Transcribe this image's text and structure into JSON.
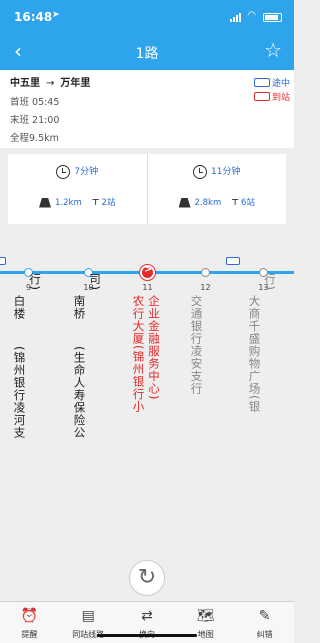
{
  "status": {
    "time": "16:48",
    "location_icon": "location-arrow-icon"
  },
  "navbar": {
    "back_icon": "‹",
    "title": "1路",
    "favorite_icon": "☆"
  },
  "info": {
    "from": "中五里",
    "arrow": "→",
    "to": "万年里",
    "first_bus": "首班 05:45",
    "last_bus": "末班 21:00",
    "length": "全程9.5km",
    "legend": [
      {
        "label": "途中",
        "color": "#2a6bd6"
      },
      {
        "label": "到站",
        "color": "#e52a2a"
      }
    ]
  },
  "cards": [
    {
      "time": "7分钟",
      "distance": "1.2km",
      "stops": "2站"
    },
    {
      "time": "11分钟",
      "distance": "2.8km",
      "stops": "6站"
    }
  ],
  "stops": [
    {
      "num": "9",
      "cols": [
        "白楼",
        "(锦州银行凌河支"
      ],
      "tail": "行)",
      "state": "upcoming"
    },
    {
      "num": "10",
      "cols": [
        "南桥",
        "(生命人寿保险公"
      ],
      "tail": "司)",
      "state": "upcoming"
    },
    {
      "num": "11",
      "cols": [
        "农行大厦(锦州银行小",
        "企业金融服务中心)"
      ],
      "tail": "",
      "state": "current"
    },
    {
      "num": "12",
      "cols": [
        "交通银行凌安支行"
      ],
      "tail": "",
      "state": "passed"
    },
    {
      "num": "13",
      "cols": [
        "大商千盛购物广场(银"
      ],
      "tail": "行)",
      "state": "passed"
    }
  ],
  "refresh_icon": "↻",
  "tabs": [
    {
      "label": "提醒",
      "icon": "⏰"
    },
    {
      "label": "同站线路",
      "icon": "▤"
    },
    {
      "label": "换向",
      "icon": "⇄"
    },
    {
      "label": "地图",
      "icon": "🗺"
    },
    {
      "label": "纠错",
      "icon": "✎"
    }
  ],
  "colors": {
    "primary": "#2ea4ec",
    "current": "#e52a2a",
    "moving": "#2a6bd6"
  }
}
